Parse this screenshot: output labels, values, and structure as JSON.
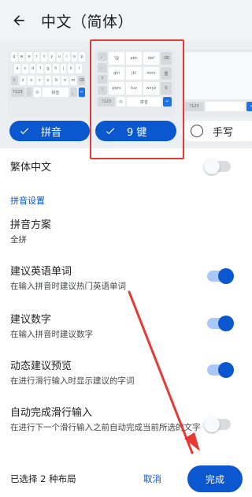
{
  "header": {
    "title": "中文（简体）",
    "back_icon": "arrow-left-icon"
  },
  "layouts": {
    "qwerty": {
      "rows": [
        [
          "q",
          "w",
          "e",
          "r",
          "t",
          "y",
          "u",
          "i",
          "o",
          "p"
        ],
        [
          "a",
          "s",
          "d",
          "f",
          "g",
          "h",
          "j",
          "k",
          "l"
        ],
        [
          "z",
          "x",
          "c",
          "v",
          "b",
          "n",
          "m"
        ]
      ],
      "bottom": {
        "symbols": "?123",
        "space": "拼音"
      }
    },
    "t9": {
      "keys": [
        [
          "'@",
          "abc",
          "def"
        ],
        [
          "ghi",
          "jkl",
          "mno"
        ],
        [
          "pqrs",
          "tuv",
          "wxyz"
        ]
      ],
      "bottom": {
        "symbols": "?123",
        "space": "拼音"
      }
    },
    "chips": [
      {
        "label": "拼音",
        "selected": true
      },
      {
        "label": "9 键",
        "selected": true
      },
      {
        "label": "手写",
        "selected": false
      }
    ]
  },
  "settings": {
    "traditional": {
      "title": "繁体中文",
      "on": false
    },
    "section_pinyin": "拼音设置",
    "scheme": {
      "title": "拼音方案",
      "value": "全拼"
    },
    "english": {
      "title": "建议英语单词",
      "sub": "在输入拼音时建议热门英语单词",
      "on": true
    },
    "numbers": {
      "title": "建议数字",
      "sub": "在输入拼音时建议数字",
      "on": true
    },
    "dynamic": {
      "title": "动态建议预览",
      "sub": "在进行滑行输入时显示建议的字词",
      "on": true
    },
    "autocomplete": {
      "title": "自动完成滑行输入",
      "sub": "在进行下一个滑行输入之前自动完成当前所选的文字",
      "on": false
    }
  },
  "footer": {
    "status": "已选择 2 种布局",
    "cancel": "取消",
    "done": "完成"
  },
  "colors": {
    "accent": "#0b57d0",
    "highlight": "#e53935"
  }
}
